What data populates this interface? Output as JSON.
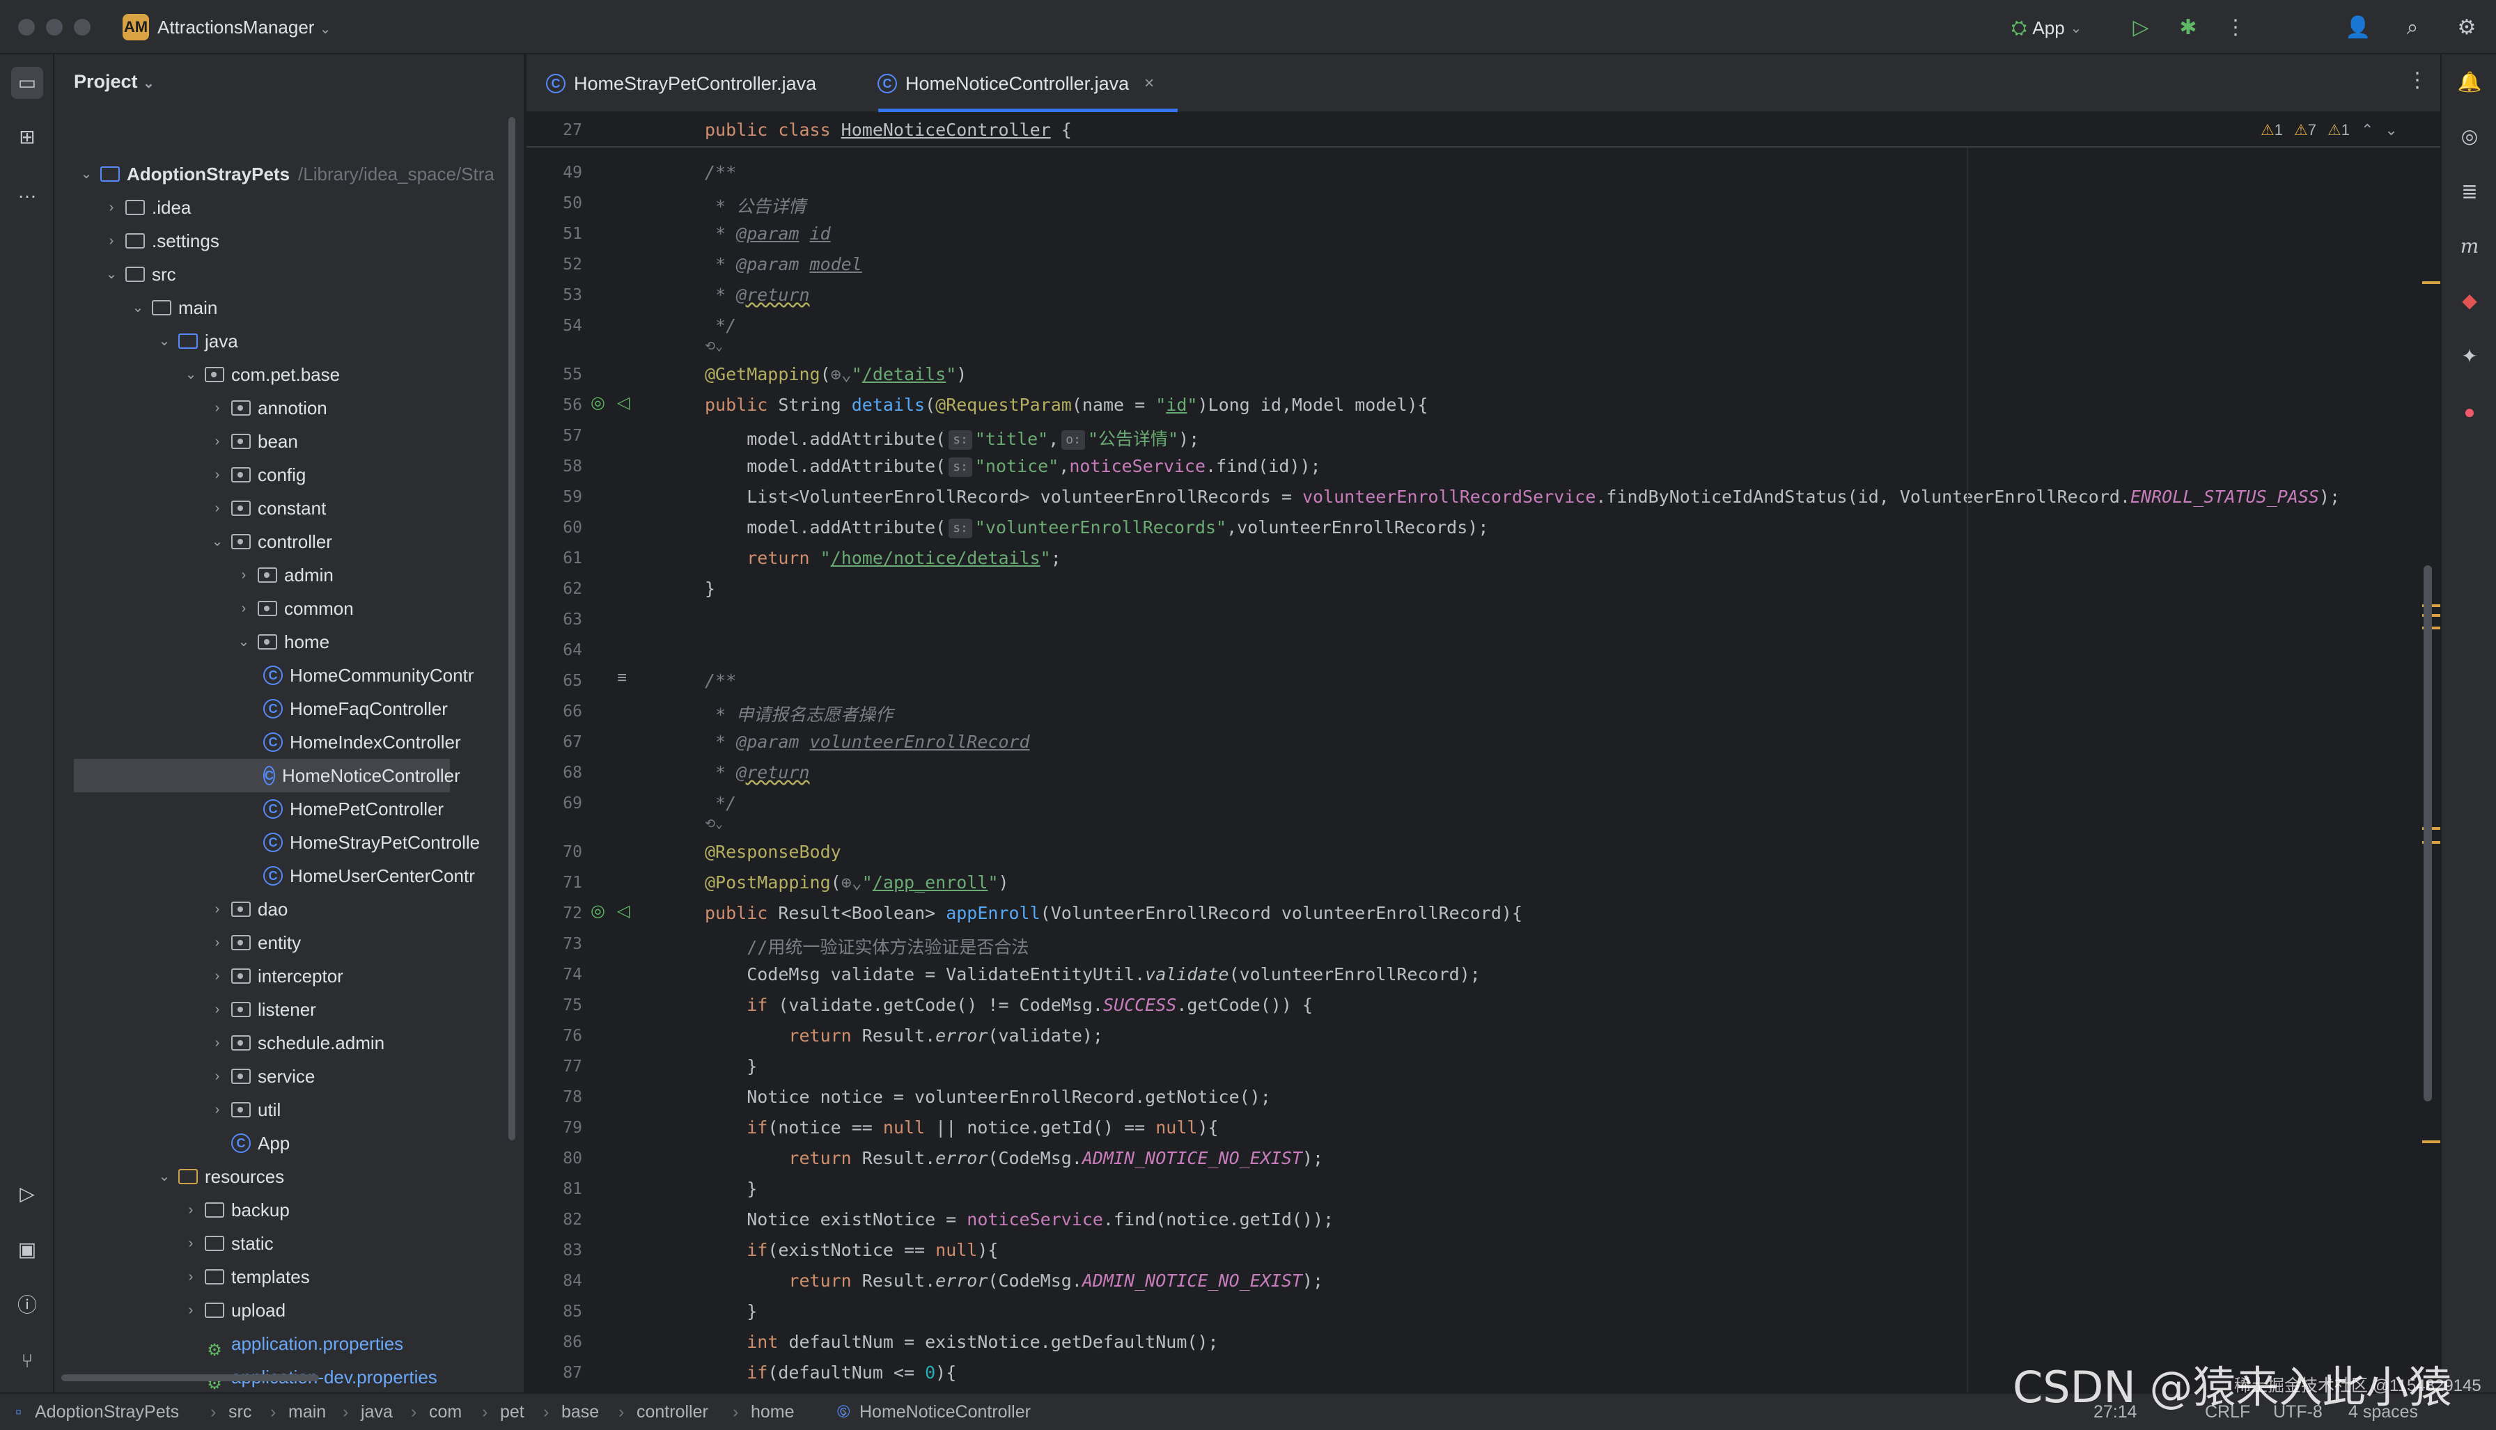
{
  "titlebar": {
    "project_badge": "AM",
    "project_name": "AttractionsManager",
    "run_config": "App"
  },
  "project_panel": {
    "header": "Project",
    "tree": [
      {
        "label": "AdoptionStrayPets",
        "extra": "/Library/idea_space/Stra"
      },
      {
        "label": ".idea"
      },
      {
        "label": ".settings"
      },
      {
        "label": "src"
      },
      {
        "label": "main"
      },
      {
        "label": "java"
      },
      {
        "label": "com.pet.base"
      },
      {
        "label": "annotion"
      },
      {
        "label": "bean"
      },
      {
        "label": "config"
      },
      {
        "label": "constant"
      },
      {
        "label": "controller"
      },
      {
        "label": "admin"
      },
      {
        "label": "common"
      },
      {
        "label": "home"
      },
      {
        "label": "HomeCommunityContr"
      },
      {
        "label": "HomeFaqController"
      },
      {
        "label": "HomeIndexController"
      },
      {
        "label": "HomeNoticeController"
      },
      {
        "label": "HomePetController"
      },
      {
        "label": "HomeStrayPetControlle"
      },
      {
        "label": "HomeUserCenterContr"
      },
      {
        "label": "dao"
      },
      {
        "label": "entity"
      },
      {
        "label": "interceptor"
      },
      {
        "label": "listener"
      },
      {
        "label": "schedule.admin"
      },
      {
        "label": "service"
      },
      {
        "label": "util"
      },
      {
        "label": "App"
      },
      {
        "label": "resources"
      },
      {
        "label": "backup"
      },
      {
        "label": "static"
      },
      {
        "label": "templates"
      },
      {
        "label": "upload"
      },
      {
        "label": "application.properties"
      },
      {
        "label": "application-dev.properties"
      }
    ]
  },
  "tabs": [
    {
      "label": "HomeStrayPetController.java"
    },
    {
      "label": "HomeNoticeController.java"
    }
  ],
  "editor": {
    "sticky_line_no": "27",
    "sticky_code": "public class HomeNoticeController {",
    "inspections": {
      "warn1": "1",
      "warn2": "7",
      "warn3": "1"
    },
    "lines": [
      "49",
      "50",
      "51",
      "52",
      "53",
      "54",
      "55",
      "56",
      "57",
      "58",
      "59",
      "60",
      "61",
      "62",
      "63",
      "64",
      "65",
      "66",
      "67",
      "68",
      "69",
      "70",
      "71",
      "72",
      "73",
      "74",
      "75",
      "76",
      "77",
      "78",
      "79",
      "80",
      "81",
      "82",
      "83",
      "84",
      "85",
      "86",
      "87"
    ]
  },
  "statusbar": {
    "breadcrumb": [
      "AdoptionStrayPets",
      "src",
      "main",
      "java",
      "com",
      "pet",
      "base",
      "controller",
      "home",
      "HomeNoticeController"
    ],
    "position": "27:14",
    "line_sep": "CRLF",
    "encoding": "UTF-8",
    "indent": "4 spaces"
  },
  "watermark": {
    "text": "CSDN @猿来入此小猿",
    "sub": "稀土掘金技术社区 @1154829145"
  },
  "colors": {
    "accent": "#3574f0",
    "keyword": "#cf8e6d",
    "string": "#6aab73",
    "field": "#c77dbb",
    "method": "#56a8f5",
    "warning": "#d9a343"
  }
}
